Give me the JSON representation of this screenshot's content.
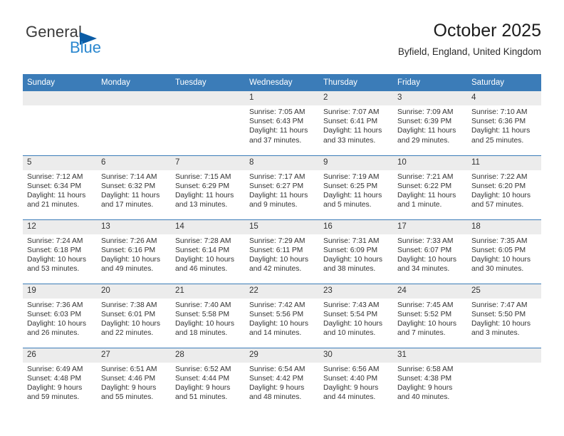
{
  "logo": {
    "word1": "General",
    "word2": "Blue",
    "triangle_icon": "triangle-right-icon",
    "color_dark": "#3b3b3b",
    "color_blue": "#2a87cf",
    "color_triangle": "#0b5ca5"
  },
  "header": {
    "title": "October 2025",
    "subtitle": "Byfield, England, United Kingdom"
  },
  "theme": {
    "header_blue": "#3b7cb8",
    "daynum_bg": "#ececec",
    "text": "#333333"
  },
  "weekday_headers": [
    "Sunday",
    "Monday",
    "Tuesday",
    "Wednesday",
    "Thursday",
    "Friday",
    "Saturday"
  ],
  "labels": {
    "sunrise_prefix": "Sunrise:",
    "sunset_prefix": "Sunset:",
    "daylight_prefix": "Daylight:"
  },
  "weeks": [
    [
      {
        "day": "",
        "empty": true
      },
      {
        "day": "",
        "empty": true
      },
      {
        "day": "",
        "empty": true
      },
      {
        "day": "1",
        "sunrise": "Sunrise: 7:05 AM",
        "sunset": "Sunset: 6:43 PM",
        "daylight_line1": "Daylight: 11 hours",
        "daylight_line2": "and 37 minutes."
      },
      {
        "day": "2",
        "sunrise": "Sunrise: 7:07 AM",
        "sunset": "Sunset: 6:41 PM",
        "daylight_line1": "Daylight: 11 hours",
        "daylight_line2": "and 33 minutes."
      },
      {
        "day": "3",
        "sunrise": "Sunrise: 7:09 AM",
        "sunset": "Sunset: 6:39 PM",
        "daylight_line1": "Daylight: 11 hours",
        "daylight_line2": "and 29 minutes."
      },
      {
        "day": "4",
        "sunrise": "Sunrise: 7:10 AM",
        "sunset": "Sunset: 6:36 PM",
        "daylight_line1": "Daylight: 11 hours",
        "daylight_line2": "and 25 minutes."
      }
    ],
    [
      {
        "day": "5",
        "sunrise": "Sunrise: 7:12 AM",
        "sunset": "Sunset: 6:34 PM",
        "daylight_line1": "Daylight: 11 hours",
        "daylight_line2": "and 21 minutes."
      },
      {
        "day": "6",
        "sunrise": "Sunrise: 7:14 AM",
        "sunset": "Sunset: 6:32 PM",
        "daylight_line1": "Daylight: 11 hours",
        "daylight_line2": "and 17 minutes."
      },
      {
        "day": "7",
        "sunrise": "Sunrise: 7:15 AM",
        "sunset": "Sunset: 6:29 PM",
        "daylight_line1": "Daylight: 11 hours",
        "daylight_line2": "and 13 minutes."
      },
      {
        "day": "8",
        "sunrise": "Sunrise: 7:17 AM",
        "sunset": "Sunset: 6:27 PM",
        "daylight_line1": "Daylight: 11 hours",
        "daylight_line2": "and 9 minutes."
      },
      {
        "day": "9",
        "sunrise": "Sunrise: 7:19 AM",
        "sunset": "Sunset: 6:25 PM",
        "daylight_line1": "Daylight: 11 hours",
        "daylight_line2": "and 5 minutes."
      },
      {
        "day": "10",
        "sunrise": "Sunrise: 7:21 AM",
        "sunset": "Sunset: 6:22 PM",
        "daylight_line1": "Daylight: 11 hours",
        "daylight_line2": "and 1 minute."
      },
      {
        "day": "11",
        "sunrise": "Sunrise: 7:22 AM",
        "sunset": "Sunset: 6:20 PM",
        "daylight_line1": "Daylight: 10 hours",
        "daylight_line2": "and 57 minutes."
      }
    ],
    [
      {
        "day": "12",
        "sunrise": "Sunrise: 7:24 AM",
        "sunset": "Sunset: 6:18 PM",
        "daylight_line1": "Daylight: 10 hours",
        "daylight_line2": "and 53 minutes."
      },
      {
        "day": "13",
        "sunrise": "Sunrise: 7:26 AM",
        "sunset": "Sunset: 6:16 PM",
        "daylight_line1": "Daylight: 10 hours",
        "daylight_line2": "and 49 minutes."
      },
      {
        "day": "14",
        "sunrise": "Sunrise: 7:28 AM",
        "sunset": "Sunset: 6:14 PM",
        "daylight_line1": "Daylight: 10 hours",
        "daylight_line2": "and 46 minutes."
      },
      {
        "day": "15",
        "sunrise": "Sunrise: 7:29 AM",
        "sunset": "Sunset: 6:11 PM",
        "daylight_line1": "Daylight: 10 hours",
        "daylight_line2": "and 42 minutes."
      },
      {
        "day": "16",
        "sunrise": "Sunrise: 7:31 AM",
        "sunset": "Sunset: 6:09 PM",
        "daylight_line1": "Daylight: 10 hours",
        "daylight_line2": "and 38 minutes."
      },
      {
        "day": "17",
        "sunrise": "Sunrise: 7:33 AM",
        "sunset": "Sunset: 6:07 PM",
        "daylight_line1": "Daylight: 10 hours",
        "daylight_line2": "and 34 minutes."
      },
      {
        "day": "18",
        "sunrise": "Sunrise: 7:35 AM",
        "sunset": "Sunset: 6:05 PM",
        "daylight_line1": "Daylight: 10 hours",
        "daylight_line2": "and 30 minutes."
      }
    ],
    [
      {
        "day": "19",
        "sunrise": "Sunrise: 7:36 AM",
        "sunset": "Sunset: 6:03 PM",
        "daylight_line1": "Daylight: 10 hours",
        "daylight_line2": "and 26 minutes."
      },
      {
        "day": "20",
        "sunrise": "Sunrise: 7:38 AM",
        "sunset": "Sunset: 6:01 PM",
        "daylight_line1": "Daylight: 10 hours",
        "daylight_line2": "and 22 minutes."
      },
      {
        "day": "21",
        "sunrise": "Sunrise: 7:40 AM",
        "sunset": "Sunset: 5:58 PM",
        "daylight_line1": "Daylight: 10 hours",
        "daylight_line2": "and 18 minutes."
      },
      {
        "day": "22",
        "sunrise": "Sunrise: 7:42 AM",
        "sunset": "Sunset: 5:56 PM",
        "daylight_line1": "Daylight: 10 hours",
        "daylight_line2": "and 14 minutes."
      },
      {
        "day": "23",
        "sunrise": "Sunrise: 7:43 AM",
        "sunset": "Sunset: 5:54 PM",
        "daylight_line1": "Daylight: 10 hours",
        "daylight_line2": "and 10 minutes."
      },
      {
        "day": "24",
        "sunrise": "Sunrise: 7:45 AM",
        "sunset": "Sunset: 5:52 PM",
        "daylight_line1": "Daylight: 10 hours",
        "daylight_line2": "and 7 minutes."
      },
      {
        "day": "25",
        "sunrise": "Sunrise: 7:47 AM",
        "sunset": "Sunset: 5:50 PM",
        "daylight_line1": "Daylight: 10 hours",
        "daylight_line2": "and 3 minutes."
      }
    ],
    [
      {
        "day": "26",
        "sunrise": "Sunrise: 6:49 AM",
        "sunset": "Sunset: 4:48 PM",
        "daylight_line1": "Daylight: 9 hours",
        "daylight_line2": "and 59 minutes."
      },
      {
        "day": "27",
        "sunrise": "Sunrise: 6:51 AM",
        "sunset": "Sunset: 4:46 PM",
        "daylight_line1": "Daylight: 9 hours",
        "daylight_line2": "and 55 minutes."
      },
      {
        "day": "28",
        "sunrise": "Sunrise: 6:52 AM",
        "sunset": "Sunset: 4:44 PM",
        "daylight_line1": "Daylight: 9 hours",
        "daylight_line2": "and 51 minutes."
      },
      {
        "day": "29",
        "sunrise": "Sunrise: 6:54 AM",
        "sunset": "Sunset: 4:42 PM",
        "daylight_line1": "Daylight: 9 hours",
        "daylight_line2": "and 48 minutes."
      },
      {
        "day": "30",
        "sunrise": "Sunrise: 6:56 AM",
        "sunset": "Sunset: 4:40 PM",
        "daylight_line1": "Daylight: 9 hours",
        "daylight_line2": "and 44 minutes."
      },
      {
        "day": "31",
        "sunrise": "Sunrise: 6:58 AM",
        "sunset": "Sunset: 4:38 PM",
        "daylight_line1": "Daylight: 9 hours",
        "daylight_line2": "and 40 minutes."
      },
      {
        "day": "",
        "empty": true
      }
    ]
  ]
}
